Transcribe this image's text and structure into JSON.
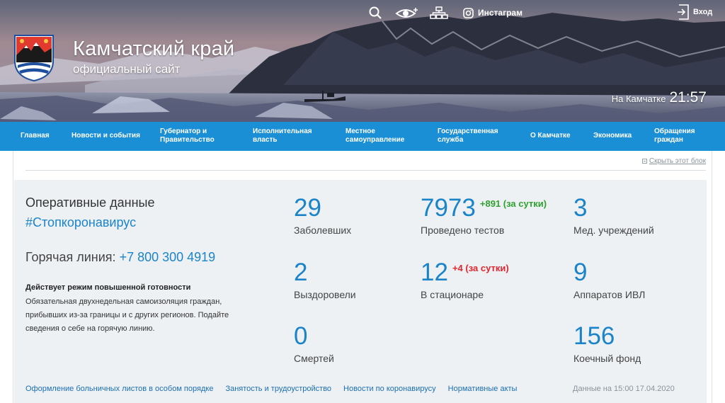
{
  "header": {
    "title": "Камчатский край",
    "subtitle": "официальный сайт",
    "tools": {
      "search_icon": "search-icon",
      "vision_icon": "low-vision-icon",
      "sitemap_icon": "sitemap-icon",
      "instagram_label": "Инстаграм"
    },
    "login_label": "Вход",
    "clock_label": "На Камчатке",
    "clock_time": "21:57"
  },
  "nav": {
    "items": [
      {
        "label": "Главная"
      },
      {
        "label": "Новости и события"
      },
      {
        "label": "Губернатор и Правительство"
      },
      {
        "label": "Исполнительная власть"
      },
      {
        "label": "Местное самоуправление"
      },
      {
        "label": "Государственная служба"
      },
      {
        "label": "О Камчатке"
      },
      {
        "label": "Экономика"
      },
      {
        "label": "Обращения граждан"
      }
    ]
  },
  "block": {
    "hide_label": "Скрыть этот блок",
    "title": "Оперативные данные",
    "hashtag": "#Стопкоронавирус",
    "hotline_label": "Горячая линия:",
    "hotline_phone": "+7 800 300 4919",
    "regime_head": "Действует режим повышенной готовности",
    "regime_text": "Обязательная двухнедельная самоизоляция граждан, прибывших из-за границы и с других регионов. Подайте сведения о себе на горячую линию.",
    "stats": {
      "infected": {
        "value": "29",
        "label": "Заболевших"
      },
      "tests": {
        "value": "7973",
        "delta": "+891 (за сутки)",
        "label": "Проведено тестов"
      },
      "hospitals": {
        "value": "3",
        "label": "Мед. учреждений"
      },
      "recovered": {
        "value": "2",
        "label": "Выздоровели"
      },
      "inpatient": {
        "value": "12",
        "delta": "+4 (за сутки)",
        "label": "В стационаре"
      },
      "ventilators": {
        "value": "9",
        "label": "Аппаратов ИВЛ"
      },
      "deaths": {
        "value": "0",
        "label": "Смертей"
      },
      "beds": {
        "value": "156",
        "label": "Коечный фонд"
      }
    },
    "links": [
      "Оформление больничных листов в особом порядке",
      "Занятость и трудоустройство",
      "Новости по коронавирусу",
      "Нормативные акты"
    ],
    "as_of": "Данные на 15:00 17.04.2020"
  },
  "colors": {
    "nav": "#1b8fd6",
    "accent": "#1b84c8",
    "increase_green": "#2ea12e",
    "increase_red": "#e0262e",
    "panel": "#eef1f4"
  }
}
